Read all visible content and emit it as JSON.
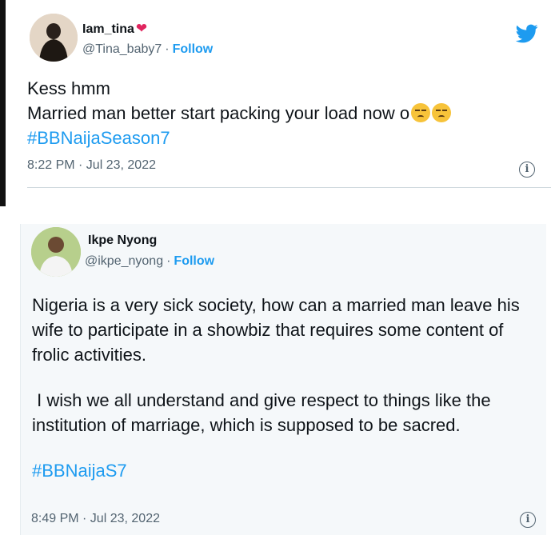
{
  "tweets": [
    {
      "display_name": "Iam_tina",
      "name_emoji": "❤",
      "handle": "@Tina_baby7",
      "follow_label": "Follow",
      "lines": [
        "Kess hmm",
        "Married man better start packing your load now o"
      ],
      "hashtag": "#BBNaijaSeason7",
      "timestamp": "8:22 PM · Jul 23, 2022"
    },
    {
      "display_name": "Ikpe Nyong",
      "handle": "@ikpe_nyong",
      "follow_label": "Follow",
      "paragraphs": [
        "Nigeria is a very sick society, how can a married man leave his wife to participate in a showbiz that requires some content of frolic activities.",
        " I wish we all understand and give respect to things like the institution of marriage, which is supposed to be sacred."
      ],
      "hashtag": "#BBNaijaS7",
      "timestamp": "8:49 PM · Jul 23, 2022"
    }
  ],
  "icons": {
    "info": "i",
    "brand": "twitter-bird",
    "emoji": "unamused-face"
  },
  "colors": {
    "link": "#1d9bf0",
    "text": "#0f1419",
    "muted": "#536471",
    "heart": "#e0245e"
  }
}
